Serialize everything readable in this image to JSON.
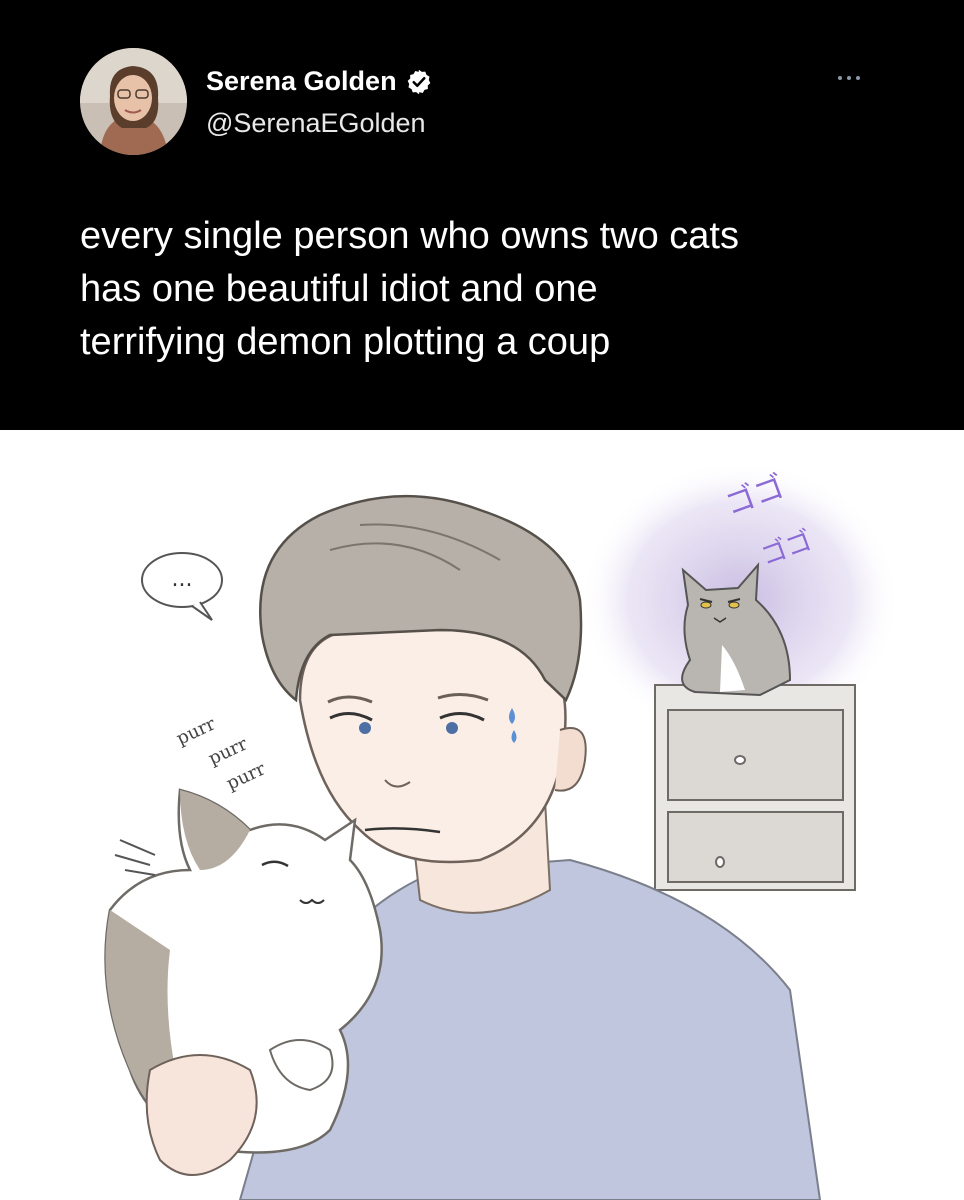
{
  "author": {
    "display_name": "Serena Golden",
    "handle": "@SerenaEGolden",
    "verified": true,
    "avatar_icon": "avatar-photo"
  },
  "menu": {
    "icon": "more-icon"
  },
  "tweet": {
    "text_lines": [
      "every single person who owns two cats",
      "has one beautiful idiot and one",
      "terrifying demon plotting a coup"
    ]
  },
  "illustration": {
    "speech_bubble": "...",
    "purr_labels": [
      "purr",
      "purr",
      "purr"
    ],
    "sfx_label": "ゴゴ"
  },
  "colors": {
    "background": "#000000",
    "text": "#ffffff",
    "verified_badge": "#ffffff",
    "aura": "#b8a6d8",
    "shirt": "#b9c1d8",
    "hair": "#a8a29a"
  }
}
